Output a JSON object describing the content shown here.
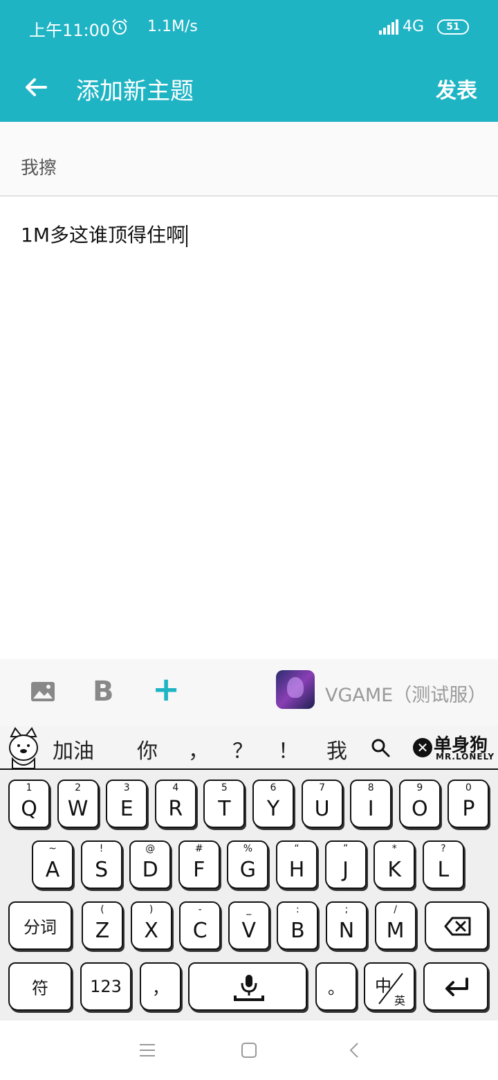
{
  "status_bar": {
    "time": "上午11:00",
    "net_speed": "1.1M/s",
    "network": "4G",
    "battery": "51"
  },
  "app_bar": {
    "title": "添加新主题",
    "publish_label": "发表"
  },
  "compose": {
    "subject_value": "我擦",
    "body_value": "1M多这谁顶得住啊"
  },
  "toolbar": {
    "bold_glyph": "B",
    "plus_glyph": "+",
    "game_name": "VGAME（测试服）"
  },
  "keyboard": {
    "candidates": [
      "加油",
      "你",
      "，",
      "？",
      "！",
      "我"
    ],
    "close_glyph": "✕",
    "brand": "单身狗",
    "brand_sub": "MR.LONELY",
    "row1": [
      {
        "main": "Q",
        "sup": "1"
      },
      {
        "main": "W",
        "sup": "2"
      },
      {
        "main": "E",
        "sup": "3"
      },
      {
        "main": "R",
        "sup": "4"
      },
      {
        "main": "T",
        "sup": "5"
      },
      {
        "main": "Y",
        "sup": "6"
      },
      {
        "main": "U",
        "sup": "7"
      },
      {
        "main": "I",
        "sup": "8"
      },
      {
        "main": "O",
        "sup": "9"
      },
      {
        "main": "P",
        "sup": "0"
      }
    ],
    "row2": [
      {
        "main": "A",
        "sup": "~"
      },
      {
        "main": "S",
        "sup": "!"
      },
      {
        "main": "D",
        "sup": "@"
      },
      {
        "main": "F",
        "sup": "#"
      },
      {
        "main": "G",
        "sup": "%"
      },
      {
        "main": "H",
        "sup": "“"
      },
      {
        "main": "J",
        "sup": "”"
      },
      {
        "main": "K",
        "sup": "*"
      },
      {
        "main": "L",
        "sup": "?"
      }
    ],
    "row3": [
      {
        "main": "Z",
        "sup": "("
      },
      {
        "main": "X",
        "sup": ")"
      },
      {
        "main": "C",
        "sup": "-"
      },
      {
        "main": "V",
        "sup": "_"
      },
      {
        "main": "B",
        "sup": ":"
      },
      {
        "main": "N",
        "sup": ";"
      },
      {
        "main": "M",
        "sup": "/"
      }
    ],
    "segment_label": "分词",
    "symbol_label": "符",
    "numeric_label": "123",
    "comma_label": "，",
    "period_label": "。",
    "lang_label_top": "中",
    "lang_label_bottom": "英"
  }
}
